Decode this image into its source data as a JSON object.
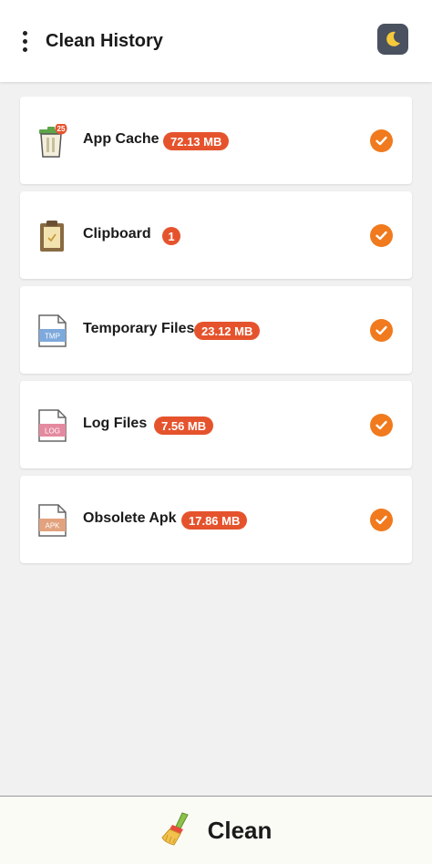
{
  "appbar": {
    "title": "Clean History",
    "menu_icon": "more-vert-icon",
    "theme_icon": "moon-icon"
  },
  "items": [
    {
      "label": "App Cache",
      "badge": "72.13 MB",
      "icon_badge": "25",
      "icon": "trash-can-icon",
      "checked": true
    },
    {
      "label": "Clipboard",
      "badge": "1",
      "icon": "clipboard-icon",
      "checked": true
    },
    {
      "label": "Temporary Files",
      "badge": "23.12 MB",
      "icon_text": "TMP",
      "icon": "tmp-file-icon",
      "checked": true
    },
    {
      "label": "Log Files",
      "badge": "7.56 MB",
      "icon_text": "LOG",
      "icon": "log-file-icon",
      "checked": true
    },
    {
      "label": "Obsolete Apk",
      "badge": "17.86 MB",
      "icon_text": "APK",
      "icon": "apk-file-icon",
      "checked": true
    }
  ],
  "bottom": {
    "label": "Clean",
    "icon": "broom-icon"
  },
  "colors": {
    "accent": "#f07a1d",
    "badge": "#e5532d",
    "background": "#f1f1f1",
    "card": "#ffffff"
  }
}
